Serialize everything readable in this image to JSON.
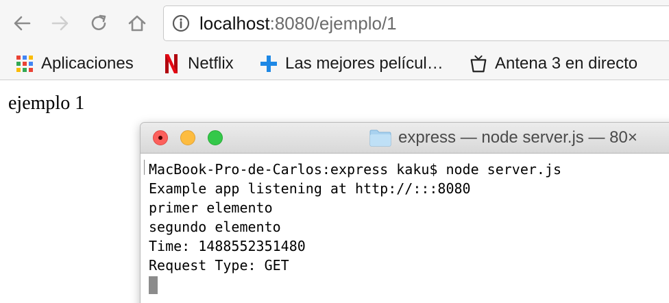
{
  "browser": {
    "toolbar": {
      "back_icon": "back-arrow-icon",
      "forward_icon": "forward-arrow-icon",
      "reload_icon": "reload-icon",
      "home_icon": "home-icon"
    },
    "omnibox": {
      "host": "localhost",
      "rest": ":8080/ejemplo/1"
    },
    "bookmarks": [
      {
        "label": "Aplicaciones",
        "icon": "apps-grid-icon"
      },
      {
        "label": "Netflix",
        "icon": "netflix-icon"
      },
      {
        "label": "Las mejores películ…",
        "icon": "plus-icon"
      },
      {
        "label": "Antena 3 en directo",
        "icon": "antena3-icon"
      }
    ]
  },
  "page": {
    "text": "ejemplo 1"
  },
  "terminal": {
    "title": "express — node server.js — 80×",
    "lines": [
      "MacBook-Pro-de-Carlos:express kaku$ node server.js",
      "Example app listening at http://:::8080",
      "primer elemento",
      "segundo elemento",
      "Time: 1488552351480",
      "Request Type: GET"
    ]
  },
  "colors": {
    "close_light": "#fc605c",
    "minimize_light": "#fdbc40",
    "maximize_light": "#34c84a",
    "netflix_red": "#e50914",
    "plus_blue": "#1e88e5"
  }
}
